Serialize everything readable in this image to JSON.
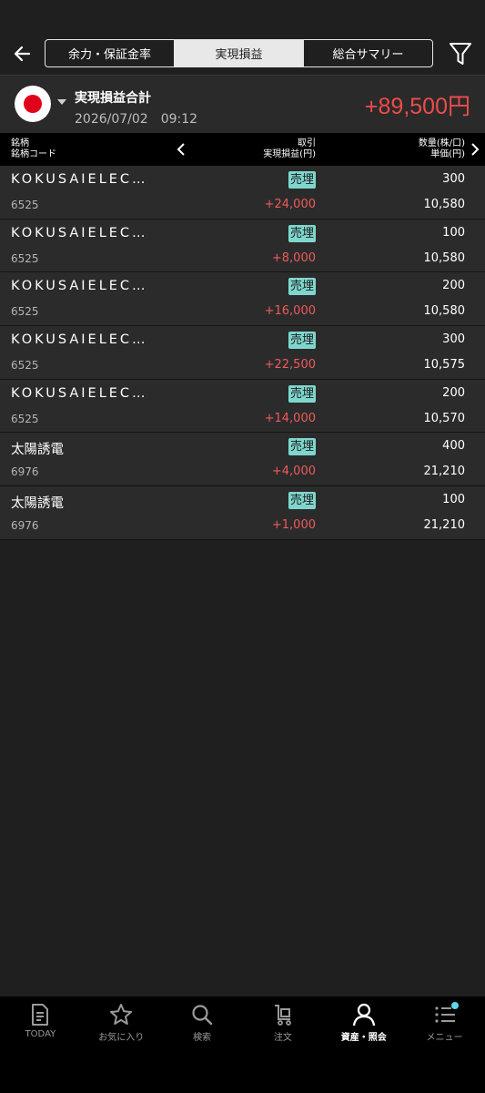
{
  "header": {
    "tabs": [
      {
        "label": "余力・保証金率",
        "active": false
      },
      {
        "label": "実現損益",
        "active": true
      },
      {
        "label": "総合サマリー",
        "active": false
      }
    ]
  },
  "summary": {
    "label": "実現損益合計",
    "date": "2026/07/02　09:12",
    "total": "+89,500円"
  },
  "columns": {
    "left_line1": "銘柄",
    "left_line2": "銘柄コード",
    "mid_line1": "取引",
    "mid_line2": "実現損益(円)",
    "right_line1": "数量(株/口)",
    "right_line2": "単価(円)"
  },
  "rows": [
    {
      "name": "KOKUSAIELEC…",
      "code": "6525",
      "type": "売埋",
      "pl": "+24,000",
      "qty": "300",
      "price": "10,580"
    },
    {
      "name": "KOKUSAIELEC…",
      "code": "6525",
      "type": "売埋",
      "pl": "+8,000",
      "qty": "100",
      "price": "10,580"
    },
    {
      "name": "KOKUSAIELEC…",
      "code": "6525",
      "type": "売埋",
      "pl": "+16,000",
      "qty": "200",
      "price": "10,580"
    },
    {
      "name": "KOKUSAIELEC…",
      "code": "6525",
      "type": "売埋",
      "pl": "+22,500",
      "qty": "300",
      "price": "10,575"
    },
    {
      "name": "KOKUSAIELEC…",
      "code": "6525",
      "type": "売埋",
      "pl": "+14,000",
      "qty": "200",
      "price": "10,570"
    },
    {
      "name": "太陽誘電",
      "code": "6976",
      "type": "売埋",
      "pl": "+4,000",
      "qty": "400",
      "price": "21,210"
    },
    {
      "name": "太陽誘電",
      "code": "6976",
      "type": "売埋",
      "pl": "+1,000",
      "qty": "100",
      "price": "21,210"
    }
  ],
  "nav": [
    {
      "label": "TODAY",
      "icon": "document-icon",
      "active": false
    },
    {
      "label": "お気に入り",
      "icon": "star-icon",
      "active": false
    },
    {
      "label": "検索",
      "icon": "search-icon",
      "active": false
    },
    {
      "label": "注文",
      "icon": "cart-icon",
      "active": false
    },
    {
      "label": "資産・照会",
      "icon": "person-icon",
      "active": true
    },
    {
      "label": "メニュー",
      "icon": "menu-icon",
      "active": false
    }
  ],
  "colors": {
    "profit": "#f04b4b",
    "badge": "#7fd6cd",
    "background": "#1f1f1f",
    "row": "#2b2b2b",
    "header_bar": "#000000"
  }
}
